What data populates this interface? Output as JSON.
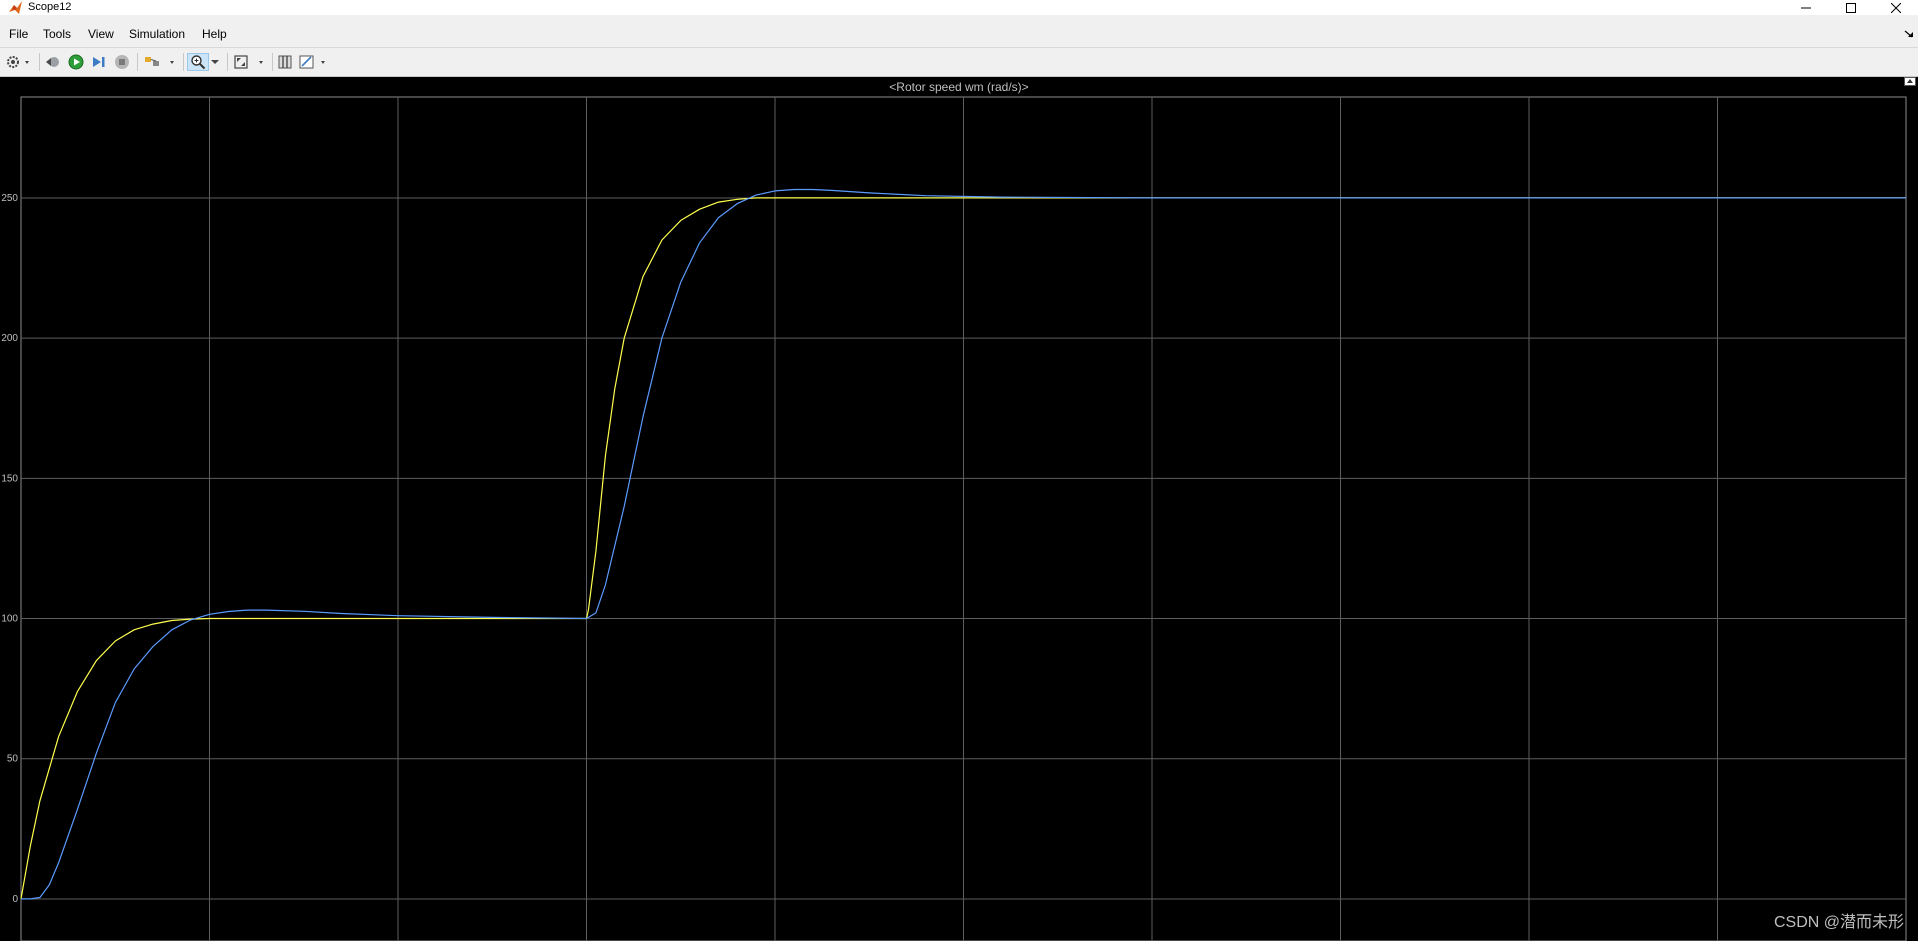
{
  "window": {
    "title": "Scope12",
    "icon": "matlab-icon"
  },
  "menu": {
    "items": [
      {
        "label": "File"
      },
      {
        "label": "Tools"
      },
      {
        "label": "View"
      },
      {
        "label": "Simulation"
      },
      {
        "label": "Help"
      }
    ]
  },
  "toolbar": {
    "icons": [
      "gear-icon",
      "step-back-icon",
      "run-icon",
      "step-forward-icon",
      "stop-icon",
      "signal-icon",
      "zoom-in-icon",
      "fit-axes-icon",
      "cursor-icon",
      "style-icon"
    ]
  },
  "plot": {
    "title": "<Rotor speed wm (rad/s)>"
  },
  "watermark": "CSDN @潜而未形",
  "colors": {
    "background": "#000000",
    "grid": "#5e5e5e",
    "series_reference": "#ffff4d",
    "series_actual": "#5b9bff"
  },
  "chart_data": {
    "type": "line",
    "title": "<Rotor speed wm (rad/s)>",
    "xlabel": "",
    "ylabel": "",
    "xlim": [
      0,
      10
    ],
    "ylim": [
      -15,
      286
    ],
    "yticks": [
      0,
      50,
      100,
      150,
      200,
      250
    ],
    "grid": true,
    "series": [
      {
        "color": "#ffff4d",
        "x": [
          0,
          0.05,
          0.1,
          0.2,
          0.3,
          0.4,
          0.5,
          0.6,
          0.7,
          0.8,
          0.9,
          1.0,
          1.2,
          1.5,
          2.0,
          2.5,
          3.0,
          3.01,
          3.05,
          3.1,
          3.15,
          3.2,
          3.3,
          3.4,
          3.5,
          3.6,
          3.7,
          3.8,
          3.9,
          4.0,
          4.5,
          5.0,
          6.0,
          7.0,
          8.0,
          9.0,
          10.0
        ],
        "y": [
          0,
          19,
          35,
          58,
          74,
          85,
          92,
          96,
          98,
          99.3,
          99.8,
          100,
          100,
          100,
          100,
          100,
          100,
          103,
          124,
          158,
          182,
          200,
          222,
          235,
          242,
          246,
          248.5,
          249.5,
          250,
          250,
          250,
          250,
          250,
          250,
          250,
          250,
          250
        ]
      },
      {
        "color": "#5b9bff",
        "x": [
          0,
          0.05,
          0.1,
          0.15,
          0.2,
          0.3,
          0.4,
          0.5,
          0.6,
          0.7,
          0.8,
          0.9,
          1.0,
          1.1,
          1.2,
          1.3,
          1.5,
          1.7,
          2.0,
          2.5,
          3.0,
          3.05,
          3.1,
          3.2,
          3.3,
          3.4,
          3.5,
          3.6,
          3.7,
          3.8,
          3.9,
          4.0,
          4.1,
          4.2,
          4.3,
          4.5,
          4.8,
          5.2,
          6.0,
          7.0,
          8.0,
          10.0
        ],
        "y": [
          0,
          0,
          0.5,
          5,
          13,
          32,
          52,
          70,
          82,
          90,
          96,
          99.5,
          101.5,
          102.5,
          103,
          103,
          102.6,
          101.8,
          101,
          100.4,
          100,
          102,
          112,
          140,
          172,
          200,
          220,
          234,
          243,
          248,
          251,
          252.5,
          253,
          253,
          252.7,
          251.8,
          250.8,
          250.3,
          250,
          250,
          250,
          250
        ]
      }
    ]
  }
}
